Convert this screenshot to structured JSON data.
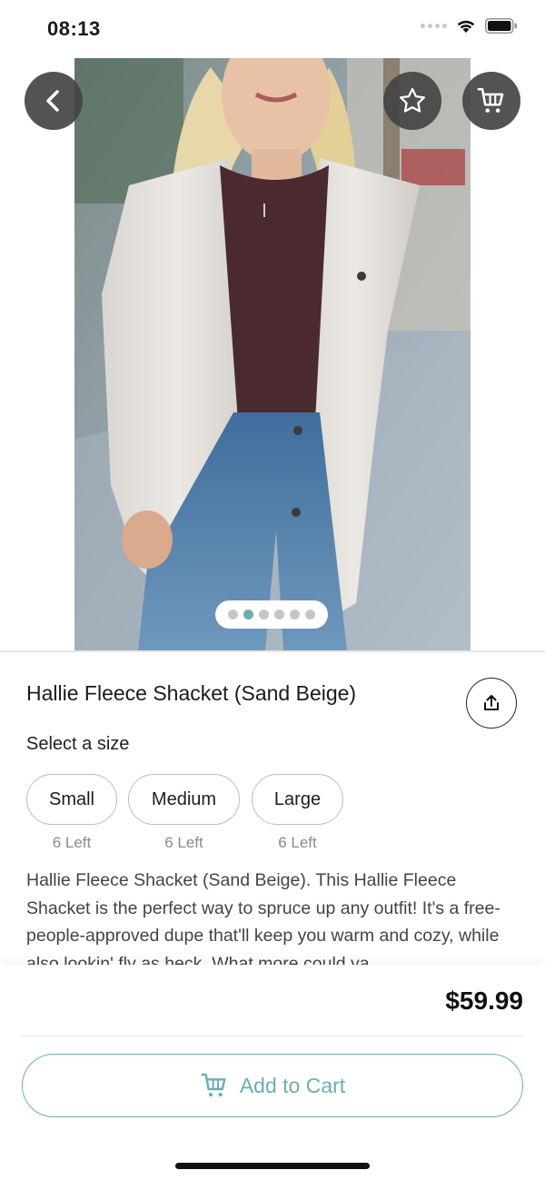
{
  "status_bar": {
    "time": "08:13"
  },
  "icons": {
    "back": "chevron-left-icon",
    "favorite": "star-outline-icon",
    "cart": "shopping-cart-icon",
    "share": "share-upload-icon",
    "add_cart": "shopping-cart-icon",
    "wifi": "wifi-icon",
    "battery": "battery-icon"
  },
  "gallery": {
    "image_count": 6,
    "active_index": 1
  },
  "product": {
    "title": "Hallie Fleece Shacket (Sand Beige)",
    "size_prompt": "Select a size",
    "sizes": [
      {
        "label": "Small",
        "stock": "6 Left"
      },
      {
        "label": "Medium",
        "stock": "6 Left"
      },
      {
        "label": "Large",
        "stock": "6 Left"
      }
    ],
    "description": "Hallie Fleece Shacket (Sand Beige). This Hallie Fleece Shacket is the perfect way to spruce up any outfit! It's a free-people-approved dupe that'll keep you warm and cozy, while also lookin' fly as heck. What more could ya"
  },
  "checkout": {
    "price": "$59.99",
    "add_to_cart_label": "Add to Cart"
  },
  "colors": {
    "accent": "#6aaeb2",
    "active_dot": "#6aaeb2",
    "button_bg": "#444444"
  }
}
